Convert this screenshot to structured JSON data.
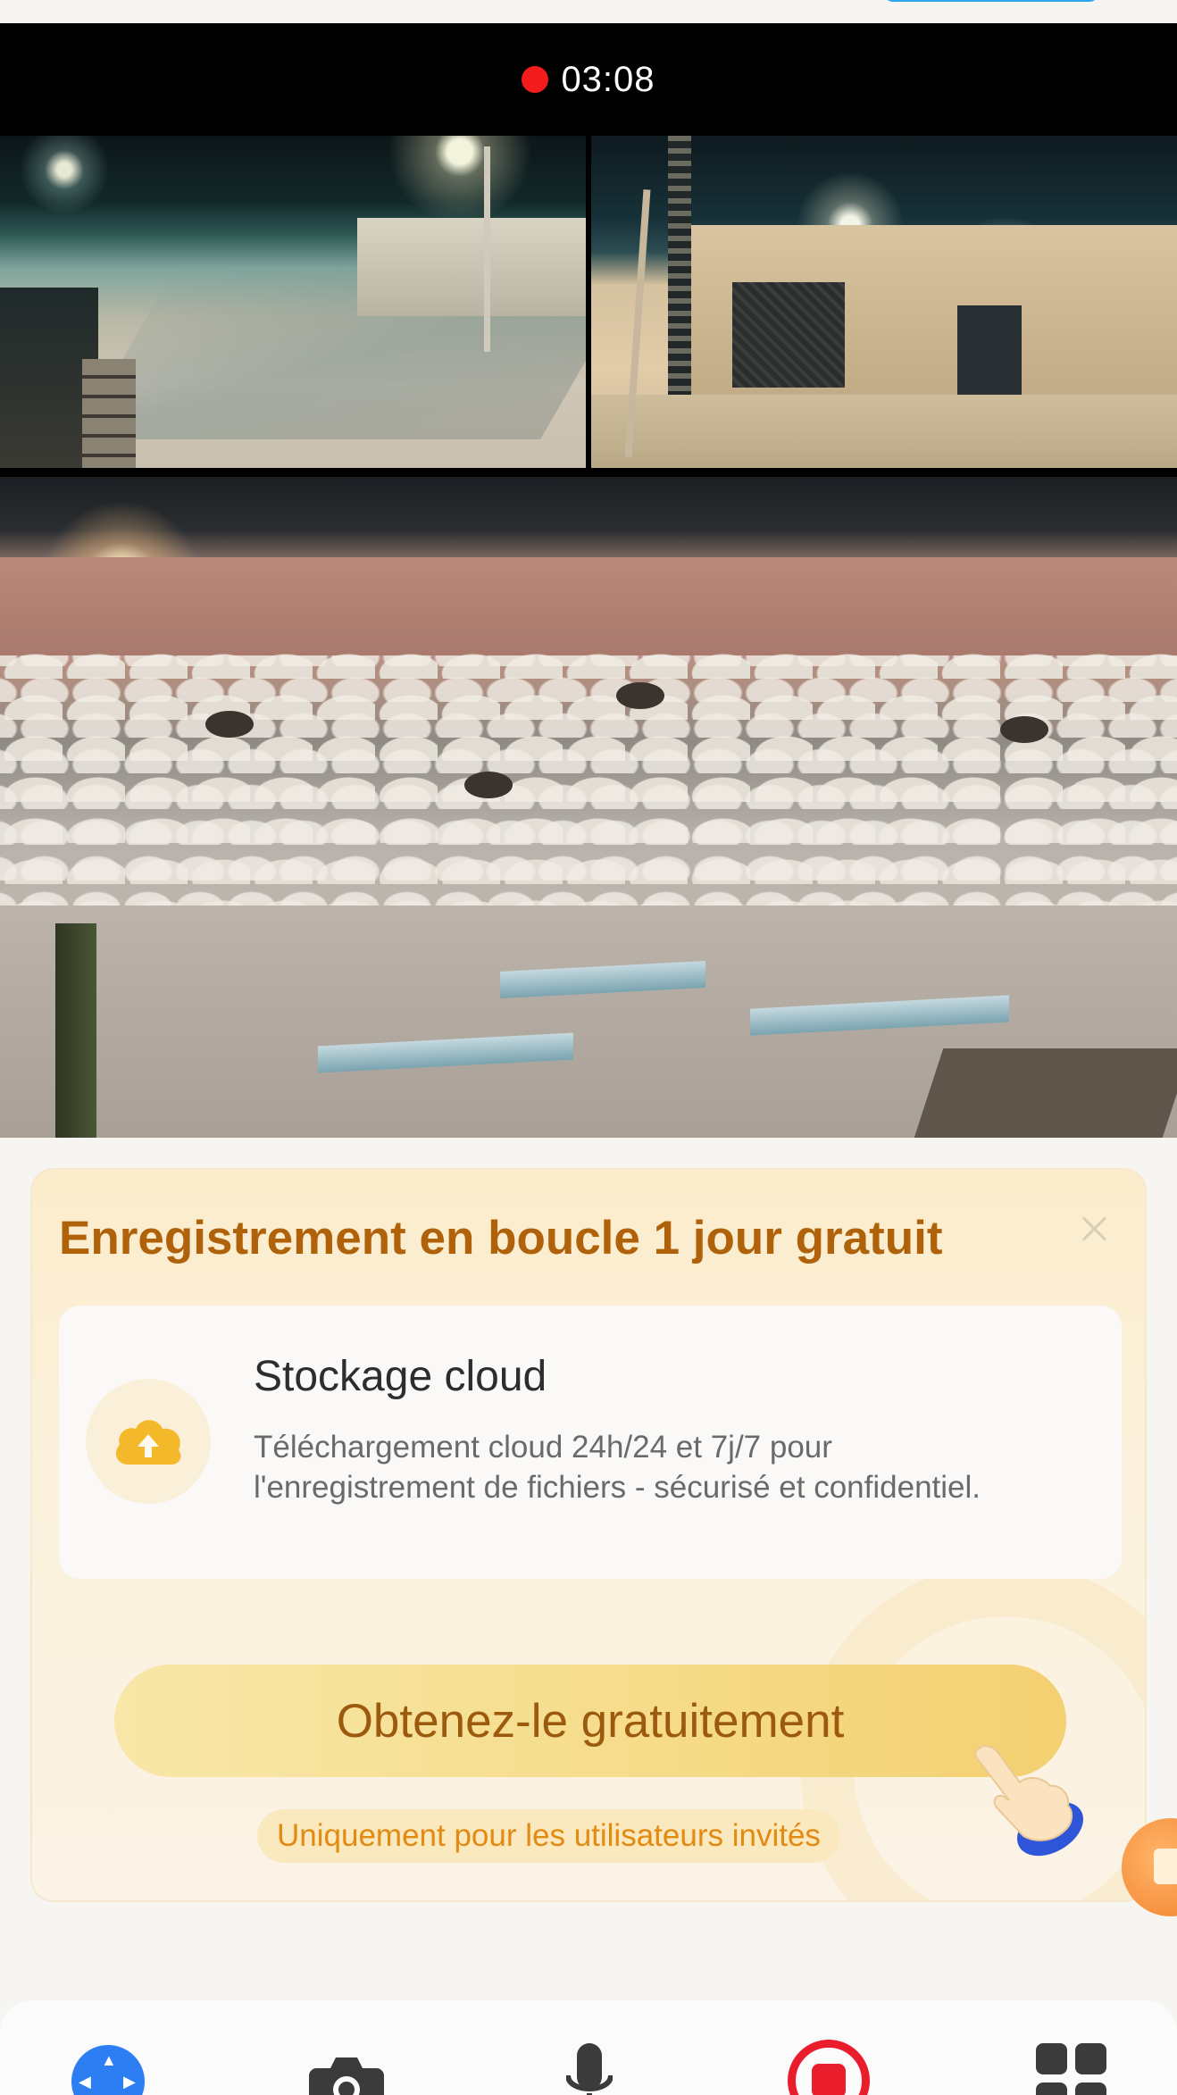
{
  "recording": {
    "time": "03:08",
    "indicator_color": "#f31b1b"
  },
  "promo": {
    "title": "Enregistrement en boucle 1 jour gratuit",
    "feature": {
      "icon": "cloud-upload-icon",
      "title": "Stockage cloud",
      "description": "Téléchargement cloud 24h/24 et 7j/7 pour l'enregistrement de fichiers - sécurisé et confidentiel."
    },
    "cta_label": "Obtenez-le gratuitement",
    "note": "Uniquement pour les utilisateurs invités",
    "accent_color": "#b0620a"
  },
  "bottom_nav": {
    "items": [
      {
        "name": "ptz-control",
        "icon": "move-arrows-icon",
        "active": true
      },
      {
        "name": "snapshot",
        "icon": "camera-icon"
      },
      {
        "name": "talk",
        "icon": "microphone-icon"
      },
      {
        "name": "record",
        "icon": "record-stop-icon",
        "color": "#ea1d2c"
      },
      {
        "name": "more",
        "icon": "grid-icon"
      }
    ]
  }
}
